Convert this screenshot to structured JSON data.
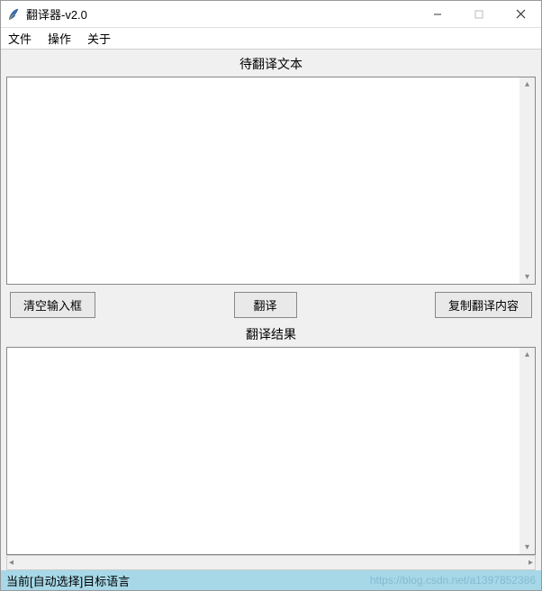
{
  "window": {
    "title": "翻译器-v2.0"
  },
  "menubar": {
    "items": [
      "文件",
      "操作",
      "关于"
    ]
  },
  "labels": {
    "source_heading": "待翻译文本",
    "result_heading": "翻译结果"
  },
  "buttons": {
    "clear_input": "清空输入框",
    "translate": "翻译",
    "copy_result": "复制翻译内容"
  },
  "textareas": {
    "source_value": "",
    "result_value": ""
  },
  "statusbar": {
    "text": "当前[自动选择]目标语言",
    "watermark": "https://blog.csdn.net/a1397852386"
  }
}
